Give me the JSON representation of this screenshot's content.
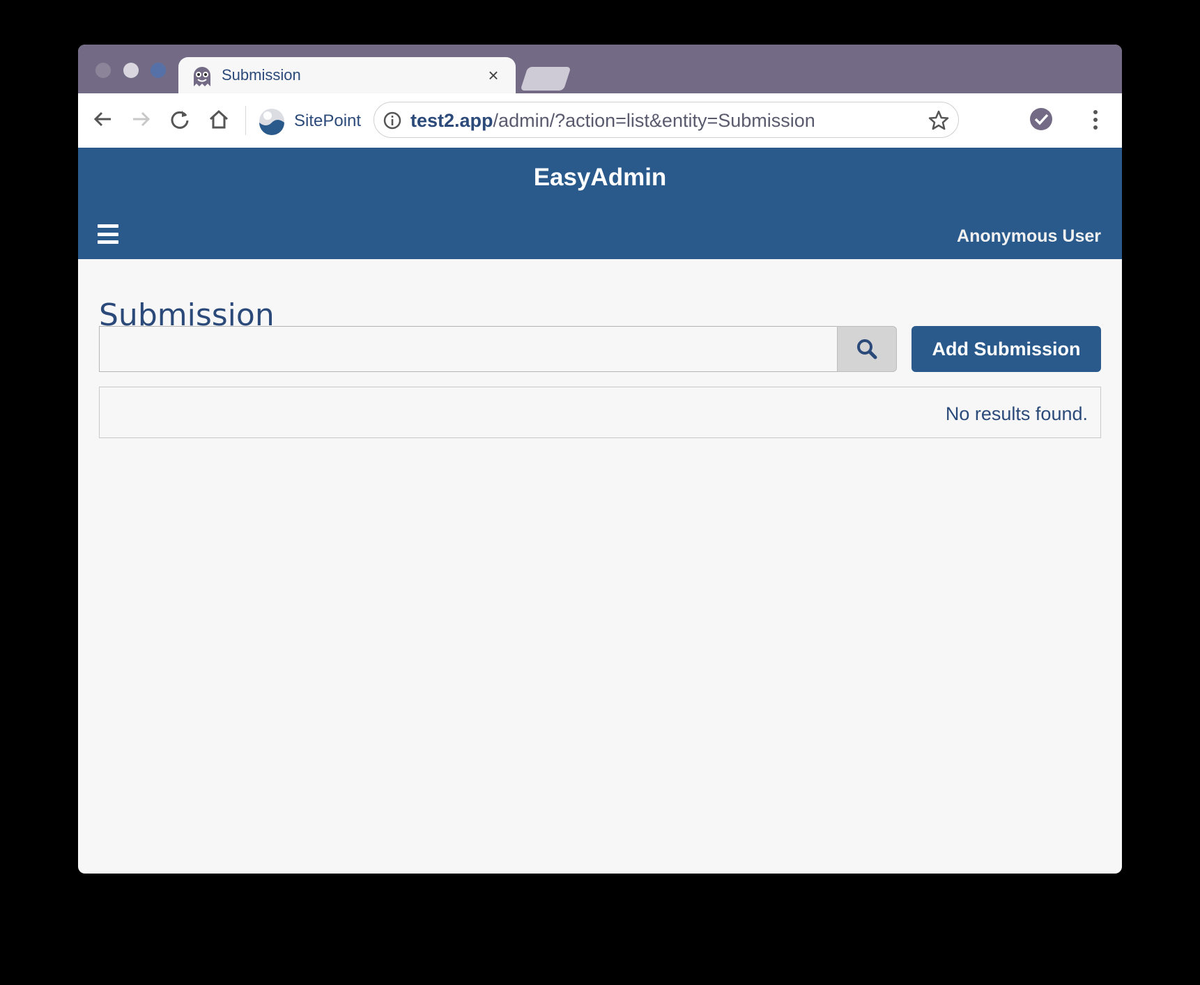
{
  "browser": {
    "tab": {
      "title": "Submission",
      "close_glyph": "×",
      "favicon": "ghost-icon"
    },
    "bookmark": {
      "label": "SitePoint",
      "icon": "sitepoint-logo-icon"
    },
    "address": {
      "host": "test2.app",
      "path": "/admin/?action=list&entity=Submission"
    },
    "icons": [
      "back-arrow-icon",
      "forward-arrow-icon",
      "reload-icon",
      "home-icon",
      "info-icon",
      "star-icon",
      "extension-check-icon",
      "more-vert-icon"
    ],
    "colors": {
      "tabstrip": "#736a85",
      "traffic_close": "#8c8599",
      "traffic_minimize": "#d9d6df",
      "traffic_zoom": "#5571a8"
    }
  },
  "app": {
    "brand": "EasyAdmin",
    "user": "Anonymous User",
    "colors": {
      "primary": "#2a5a8c",
      "text": "#2b4a7a",
      "background": "#f7f7f7"
    }
  },
  "page": {
    "title": "Submission",
    "search": {
      "value": "",
      "placeholder": ""
    },
    "add_button_label": "Add Submission",
    "empty_message": "No results found."
  }
}
